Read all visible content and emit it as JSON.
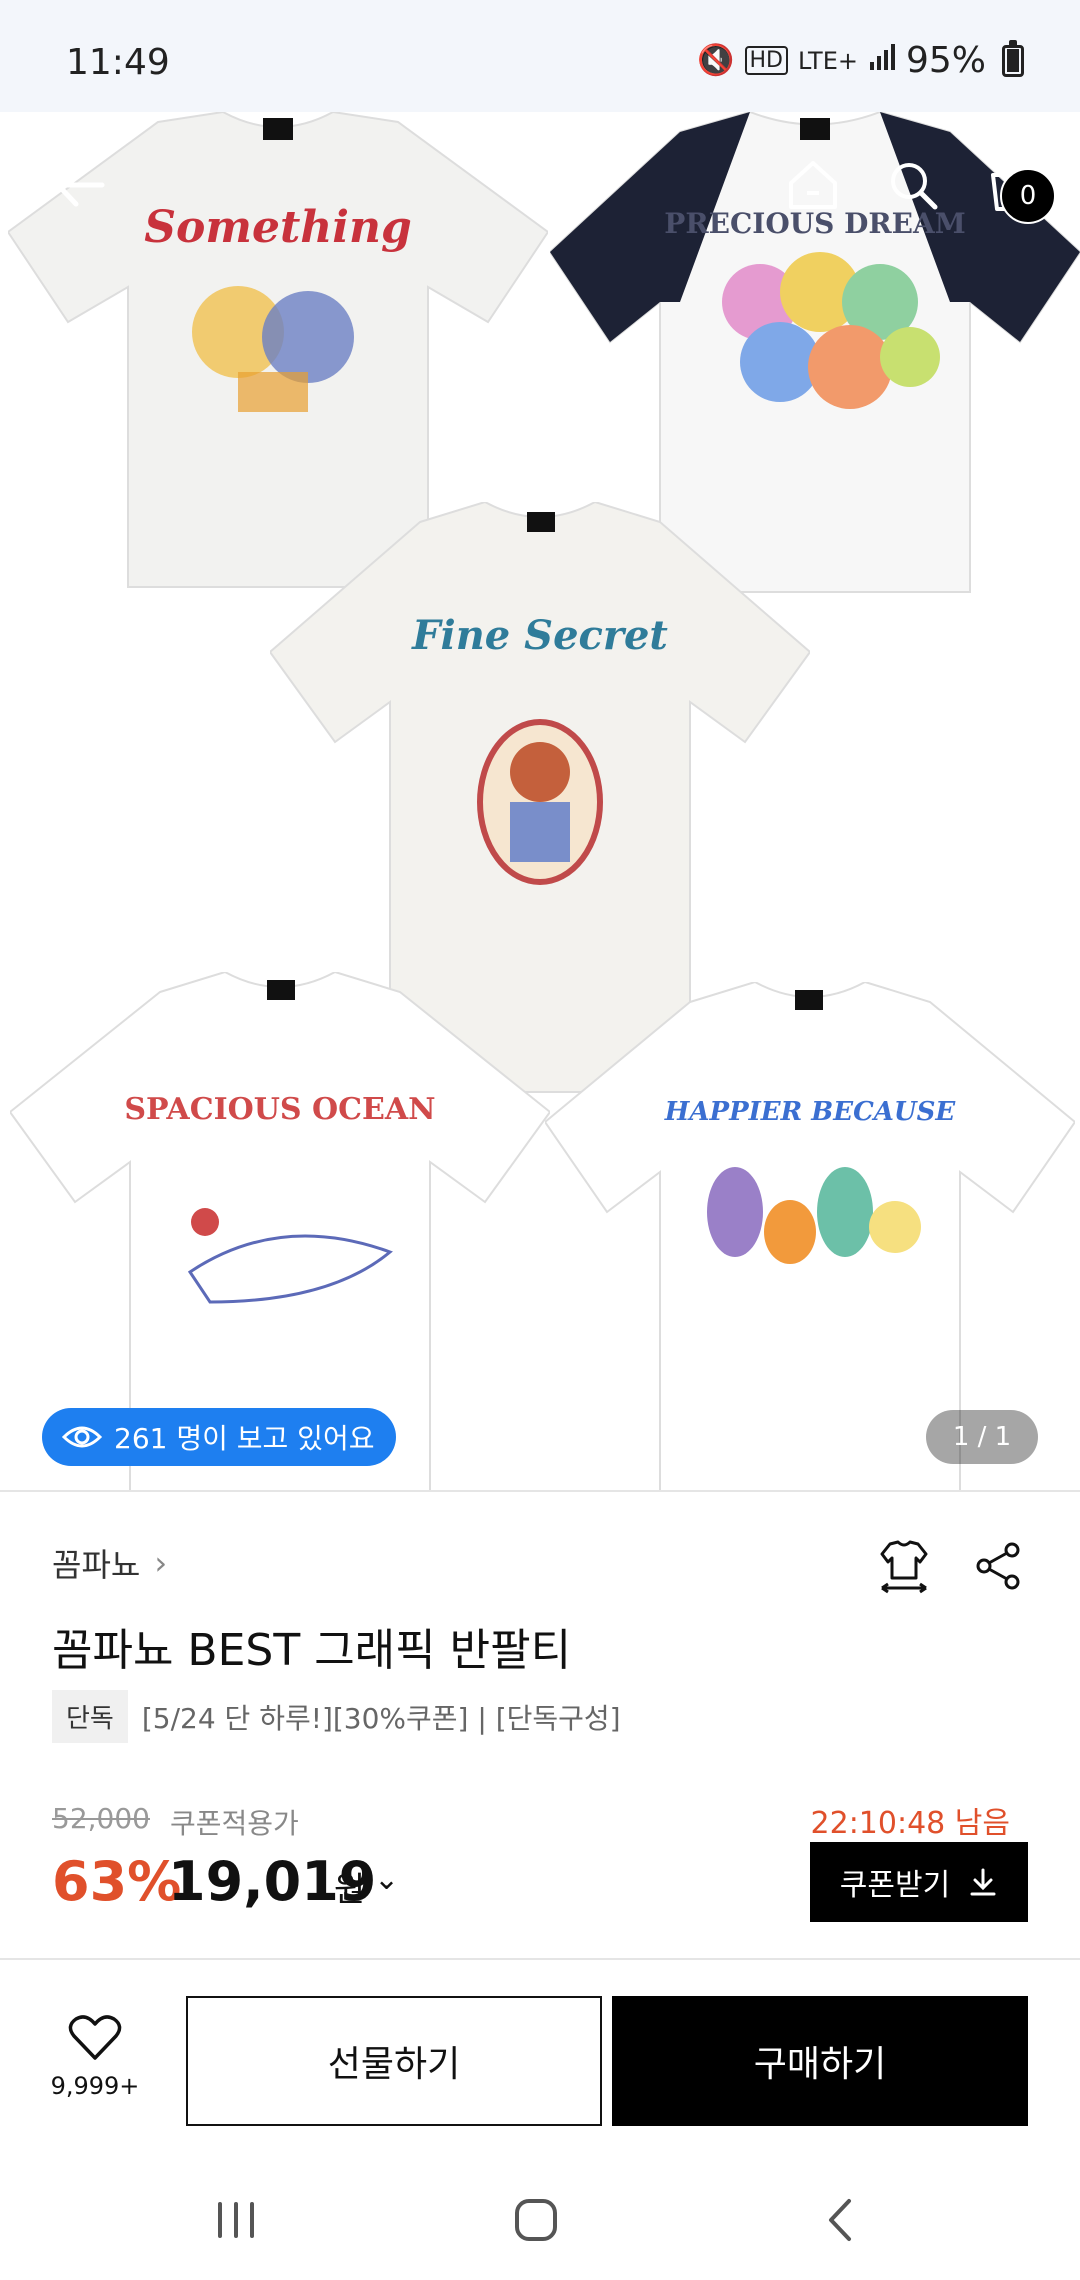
{
  "status_bar": {
    "time": "11:49",
    "network": "LTE+",
    "battery": "95%"
  },
  "hero": {
    "tee_prints": [
      {
        "text": "Something",
        "color": "#c8323c"
      },
      {
        "text": "PRECIOUS DREAM",
        "color": "#4a4f6a"
      },
      {
        "text": "Fine Secret",
        "color": "#2f7c9a"
      },
      {
        "text": "SPACIOUS OCEAN",
        "color": "#d04a4a"
      },
      {
        "text": "HAPPIER BECAUSE",
        "color": "#3b6fd1"
      }
    ],
    "cart_count": "0",
    "viewers": "261 명이 보고 있어요",
    "page_counter": "1 / 1"
  },
  "product": {
    "brand": "꼼파뇨",
    "title": "꼼파뇨 BEST 그래픽 반팔티",
    "tag_chip": "단독",
    "tag_text": "[5/24 단 하루!][30%쿠폰] | [단독구성]",
    "original_price": "52,000",
    "coupon_label": "쿠폰적용가",
    "timer": "22:10:48 남음",
    "discount": "63%",
    "price": "19,019",
    "currency": "원",
    "coupon_button": "쿠폰받기"
  },
  "actions": {
    "like_count": "9,999+",
    "gift": "선물하기",
    "buy": "구매하기"
  },
  "colors": {
    "accent_orange": "#e0502b",
    "viewer_blue": "#1e7ff0",
    "black": "#000000"
  }
}
